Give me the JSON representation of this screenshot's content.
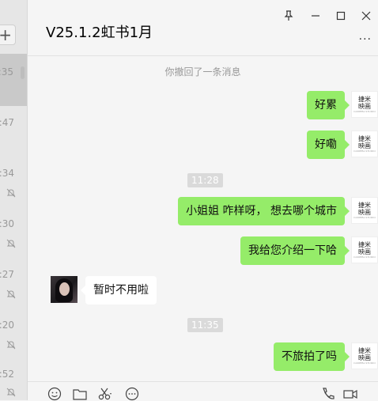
{
  "sidebar": {
    "add_label": "+",
    "times": [
      ":35",
      ":47",
      ":34",
      ":30",
      ":27",
      ":20",
      ":52"
    ]
  },
  "header": {
    "title": "V25.1.2虹书1月",
    "more_label": "..."
  },
  "window_controls": {
    "pin": "pin-icon",
    "minimize": "minimize-icon",
    "maximize": "maximize-icon",
    "close": "close-icon"
  },
  "messages": {
    "recall_notice": "你撤回了一条消息",
    "m1": "好累",
    "m2": "好嘞",
    "time1": "11:28",
    "m3": "小姐姐 咋样呀， 想去哪个城市",
    "m4": "我给您介绍一下哈",
    "m5": "暂时不用啦",
    "time2": "11:35",
    "m6": "不旅拍了吗"
  },
  "brand_avatar": {
    "line1": "捷米",
    "line2": "映画",
    "tiny": "CAMERA STUDIO"
  },
  "toolbar": {
    "icons": [
      "emoji-icon",
      "folder-icon",
      "scissors-icon",
      "chat-bubble-icon",
      "phone-icon",
      "video-icon"
    ]
  },
  "colors": {
    "my_bubble": "#95ec69",
    "other_bubble": "#ffffff",
    "background": "#f5f5f5"
  }
}
